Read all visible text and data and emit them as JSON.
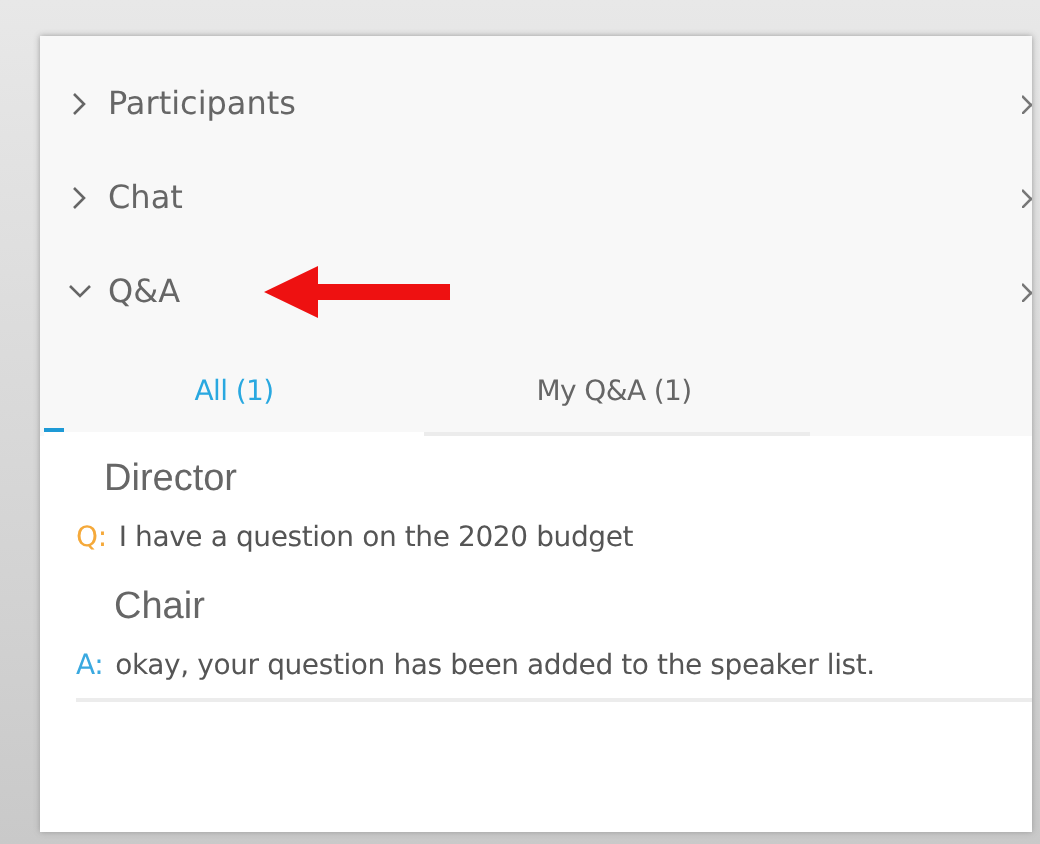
{
  "sections": [
    {
      "label": "Participants",
      "expanded": false,
      "pointed": false
    },
    {
      "label": "Chat",
      "expanded": false,
      "pointed": false
    },
    {
      "label": "Q&A",
      "expanded": true,
      "pointed": true
    }
  ],
  "tabs": [
    {
      "label": "All (1)",
      "selected": true
    },
    {
      "label": "My Q&A (1)",
      "selected": false
    }
  ],
  "messages": [
    {
      "author": "Director",
      "prefix": "Q:",
      "kind": "question",
      "text": "I have a question on the 2020 budget"
    },
    {
      "author": "Chair",
      "prefix": "A:",
      "kind": "answer",
      "text": "okay, your question has been added to the speaker list."
    }
  ]
}
